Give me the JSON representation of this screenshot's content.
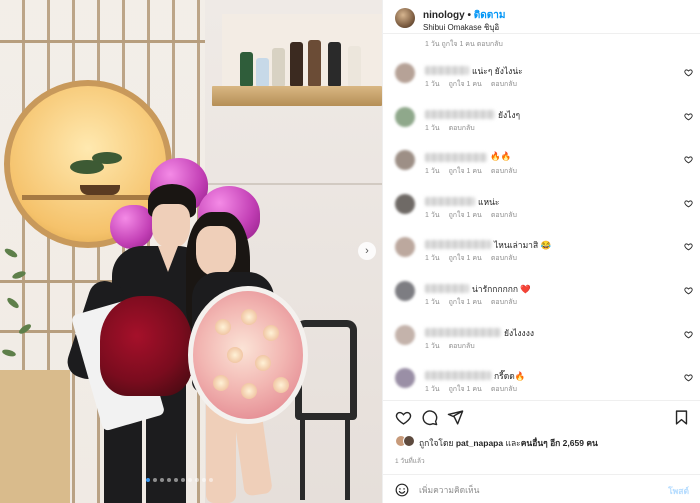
{
  "header": {
    "username": "ninology",
    "separator": " • ",
    "follow_label": "ติดตาม",
    "location": "Shibui Omakase ชิบุอิ"
  },
  "comments_top_meta": "1 วัน   ถูกใจ 1 คน   ตอบกลับ",
  "comments": [
    {
      "text": "แน่ะๆ ยังไงน่ะ",
      "time": "1 วัน",
      "likes": "ถูกใจ 1 คน",
      "reply": "ตอบกลับ"
    },
    {
      "text": "ยังไงๆ",
      "time": "1 วัน",
      "likes": "",
      "reply": "ตอบกลับ"
    },
    {
      "text": "🔥🔥",
      "time": "1 วัน",
      "likes": "ถูกใจ 1 คน",
      "reply": "ตอบกลับ"
    },
    {
      "text": "แหน่ะ",
      "time": "1 วัน",
      "likes": "ถูกใจ 1 คน",
      "reply": "ตอบกลับ"
    },
    {
      "text": "ไหนเล่ามาสิ 😂",
      "time": "1 วัน",
      "likes": "ถูกใจ 1 คน",
      "reply": "ตอบกลับ"
    },
    {
      "text": "น่ารักกกกกก ❤️",
      "time": "1 วัน",
      "likes": "ถูกใจ 1 คน",
      "reply": "ตอบกลับ"
    },
    {
      "text": "ยังไงงงง",
      "time": "1 วัน",
      "likes": "",
      "reply": "ตอบกลับ"
    },
    {
      "text": "กรี๊ดด🔥",
      "time": "1 วัน",
      "likes": "ถูกใจ 1 คน",
      "reply": "ตอบกลับ"
    }
  ],
  "likes": {
    "prefix": "ถูกใจโดย ",
    "user": "pat_napapa",
    "middle": " และ",
    "others": "คนอื่นๆ อีก 2,659 คน"
  },
  "post_time": "1 วันที่แล้ว",
  "add_comment": {
    "placeholder": "เพิ่มความคิดเห็น",
    "post_label": "โพสต์"
  },
  "photo": {
    "next_icon": "chevron-right-icon",
    "slide_count": 10,
    "active_slide": 1
  },
  "colors": {
    "link_blue": "#0095f6",
    "secondary_text": "#8e8e8e",
    "heart_red": "#ed4956"
  }
}
